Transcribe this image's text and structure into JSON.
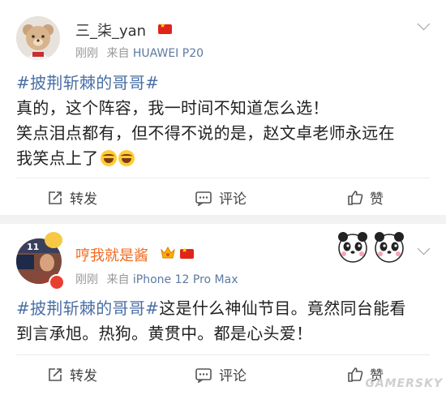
{
  "posts": [
    {
      "username": "三_柒_yan",
      "time": "刚刚",
      "source_prefix": "来自",
      "source": "HUAWEI P20",
      "topic": "#披荆斩棘的哥哥#",
      "lines": [
        "真的，这个阵容，我一时间不知道怎么选！",
        "笑点泪点都有，但不得不说的是，赵文卓老师永远在",
        "我笑点上了"
      ],
      "actions": {
        "repost": "转发",
        "comment": "评论",
        "like": "赞"
      }
    },
    {
      "username": "哼我就是酱",
      "time": "刚刚",
      "source_prefix": "来自",
      "source": "iPhone 12 Pro Max",
      "topic": "#披荆斩棘的哥哥#",
      "line1_rest": "这是什么神仙节目。竟然同台能看",
      "line2": "到言承旭。热狗。黄贯中。都是心头爱！",
      "avatar_badge": "11",
      "actions": {
        "repost": "转发",
        "comment": "评论",
        "like": "赞"
      }
    }
  ],
  "watermark": "GAMERSKY",
  "colors": {
    "topic": "#4a6fa5",
    "vip_name": "#f36a1f",
    "meta": "#999999",
    "separator": "#f2f2f2"
  }
}
